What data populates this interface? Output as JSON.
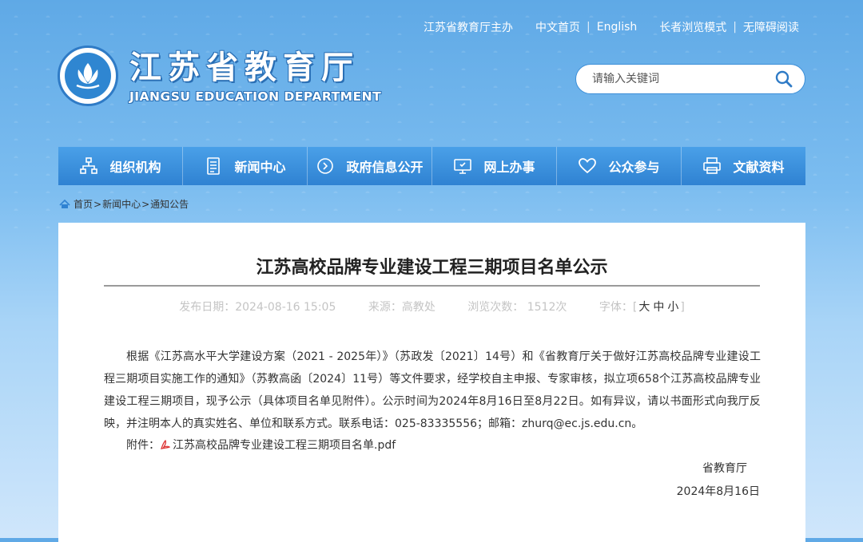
{
  "top_links": {
    "sponsor": "江苏省教育厅主办",
    "chinese_home": "中文首页",
    "english": "English",
    "elder_mode": "长者浏览模式",
    "accessible": "无障碍阅读",
    "separator": "|"
  },
  "logo": {
    "name_cn": "江苏省教育厅",
    "name_en": "JIANGSU EDUCATION DEPARTMENT"
  },
  "search": {
    "placeholder": "请输入关键词",
    "icon": "search-icon"
  },
  "nav": {
    "items": [
      {
        "label": "组织机构",
        "icon": "org-chart-icon"
      },
      {
        "label": "新闻中心",
        "icon": "document-icon"
      },
      {
        "label": "政府信息公开",
        "icon": "disclosure-icon"
      },
      {
        "label": "网上办事",
        "icon": "monitor-icon"
      },
      {
        "label": "公众参与",
        "icon": "heart-icon"
      },
      {
        "label": "文献资料",
        "icon": "printer-icon"
      }
    ]
  },
  "breadcrumb": {
    "home": "首页",
    "news": "新闻中心",
    "current": "通知公告",
    "arrow": ">"
  },
  "article": {
    "title": "江苏高校品牌专业建设工程三期项目名单公示",
    "publish_date": "发布日期：2024-08-16 15:05",
    "source": "来源：高教处",
    "views": "浏览次数：  1512次",
    "font_label": "字体：[",
    "font_large": "大",
    "font_medium": "中",
    "font_small": "小",
    "font_close": "]",
    "body": "根据《江苏高水平大学建设方案（2021 - 2025年）》（苏政发〔2021〕14号）和《省教育厅关于做好江苏高校品牌专业建设工程三期项目实施工作的通知》（苏教高函〔2024〕11号）等文件要求，经学校自主申报、专家审核，拟立项658个江苏高校品牌专业建设工程三期项目，现予公示（具体项目名单见附件）。公示时间为2024年8月16日至8月22日。如有异议，请以书面形式向我厅反映，并注明本人的真实姓名、单位和联系方式。联系电话：025-83335556；邮箱：zhurq@ec.js.edu.cn。",
    "attachment_label": "附件：",
    "attachment_file": "江苏高校品牌专业建设工程三期项目名单.pdf",
    "signature": "省教育厅",
    "sign_date": "2024年8月16日"
  },
  "colors": {
    "nav_bg": "#2f82d2",
    "brand_blue": "#2a6fb5",
    "meta_gray": "#c4c4c4"
  }
}
